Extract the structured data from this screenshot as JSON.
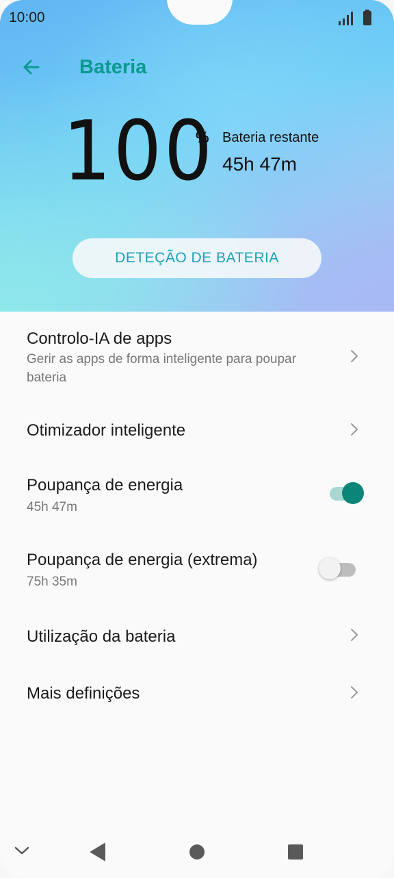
{
  "status_bar": {
    "time": "10:00"
  },
  "header": {
    "title": "Bateria"
  },
  "battery": {
    "level": "100",
    "percent_sign": "%",
    "remaining_label": "Bateria restante",
    "remaining_value": "45h 47m"
  },
  "detect_button": {
    "label": "DETEÇÃO DE BATERIA"
  },
  "settings": [
    {
      "title": "Controlo-IA de apps",
      "subtitle": "Gerir as apps de forma inteligente para poupar bateria",
      "control": "chevron"
    },
    {
      "title": "Otimizador inteligente",
      "subtitle": "",
      "control": "chevron"
    },
    {
      "title": "Poupança de energia",
      "subtitle": "45h 47m",
      "control": "toggle",
      "on": true
    },
    {
      "title": "Poupança de energia (extrema)",
      "subtitle": "75h 35m",
      "control": "toggle",
      "on": false
    },
    {
      "title": "Utilização da bateria",
      "subtitle": "",
      "control": "chevron"
    },
    {
      "title": "Mais definições",
      "subtitle": "",
      "control": "chevron"
    }
  ],
  "colors": {
    "accent": "#0b9a90",
    "toggle_on": "#0b8577",
    "detect_text": "#1aa0b8"
  }
}
